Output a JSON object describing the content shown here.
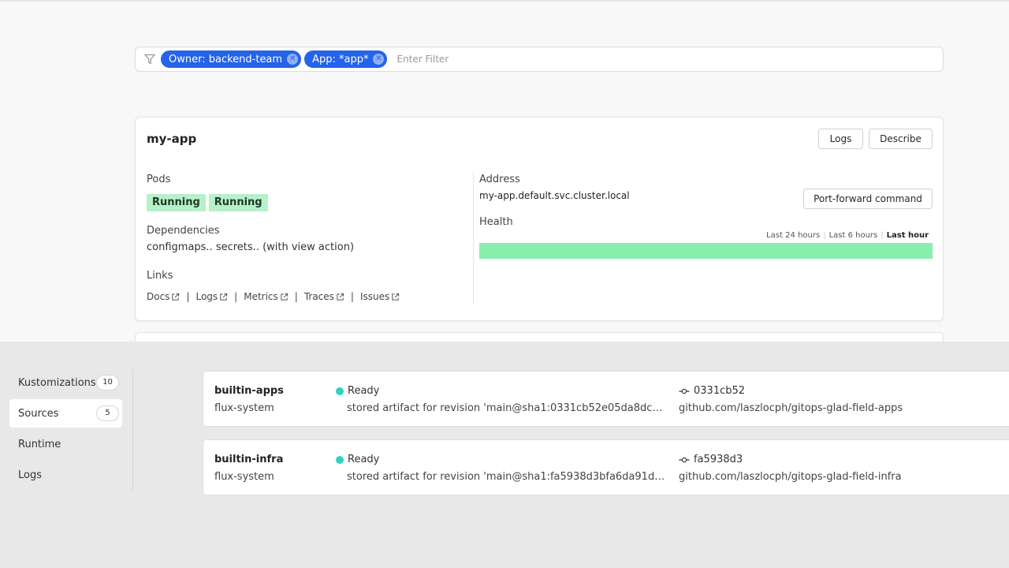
{
  "filter": {
    "chips": [
      {
        "label": "Owner: backend-team"
      },
      {
        "label": "App: *app*"
      }
    ],
    "placeholder": "Enter Filter"
  },
  "card": {
    "title": "my-app",
    "buttons": {
      "logs": "Logs",
      "describe": "Describe",
      "port_forward": "Port-forward command"
    },
    "pods_label": "Pods",
    "pods": [
      "Running",
      "Running"
    ],
    "dependencies_label": "Dependencies",
    "dependencies_value": "configmaps.. secrets.. (with view action)",
    "links_label": "Links",
    "links": [
      "Docs",
      "Logs",
      "Metrics",
      "Traces",
      "Issues"
    ],
    "address_label": "Address",
    "address_value": "my-app.default.svc.cluster.local",
    "health_label": "Health",
    "health_ranges": [
      "Last 24 hours",
      "Last 6 hours",
      "Last hour"
    ],
    "health_active_range": "Last hour",
    "health_color": "#86efac"
  },
  "sidenav": {
    "items": [
      {
        "label": "Kustomizations",
        "count": "10"
      },
      {
        "label": "Sources",
        "count": "5",
        "active": true
      },
      {
        "label": "Runtime"
      },
      {
        "label": "Logs"
      }
    ]
  },
  "sources": [
    {
      "name": "builtin-apps",
      "namespace": "flux-system",
      "status": "Ready",
      "message": "stored artifact for revision 'main@sha1:0331cb52e05da8dc3…",
      "revision": "0331cb52",
      "url": "github.com/laszlocph/gitops-glad-field-apps"
    },
    {
      "name": "builtin-infra",
      "namespace": "flux-system",
      "status": "Ready",
      "message": "stored artifact for revision 'main@sha1:fa5938d3bfa6da91d…",
      "revision": "fa5938d3",
      "url": "github.com/laszlocph/gitops-glad-field-infra"
    }
  ],
  "colors": {
    "accent": "#2563eb",
    "status_ready": "#2dd4bf",
    "pod_running": "#b7f0c9"
  }
}
